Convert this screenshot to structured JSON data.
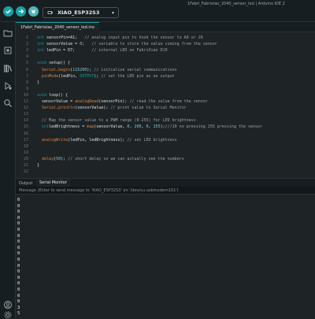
{
  "window": {
    "title": "1Fabri_Fabrixiao_2040_sensor_led | Arduino IDE 2"
  },
  "toolbar": {
    "board": "XIAO_ESP32S3"
  },
  "tabs": {
    "file": "1Fabri_Fabrixiao_2040_sensor_led.ino"
  },
  "code": [
    {
      "n": "1",
      "parts": [
        [
          "kw",
          "int"
        ],
        [
          "",
          "sensorPin=A1;   "
        ],
        [
          "cm",
          "// analog input pin to hook the sensor to A0 or 26"
        ]
      ]
    },
    {
      "n": "2",
      "parts": [
        [
          "kw",
          "int"
        ],
        [
          "",
          "sensorValue = "
        ],
        [
          "num",
          "0"
        ],
        [
          "",
          ";   "
        ],
        [
          "cm",
          "// variable to store the value coming from the sensor"
        ]
      ]
    },
    {
      "n": "3",
      "parts": [
        [
          "kw",
          "int"
        ],
        [
          "",
          "ledPin = D7;       "
        ],
        [
          "cm",
          "// internal LED on FabriXiao D10"
        ]
      ]
    },
    {
      "n": "4",
      "parts": []
    },
    {
      "n": "5",
      "parts": [
        [
          "kw",
          "void"
        ],
        [
          "",
          "setup() {"
        ]
      ]
    },
    {
      "n": "6",
      "parts": [
        [
          "",
          "  "
        ],
        [
          "fn",
          "Serial"
        ],
        [
          "",
          "."
        ],
        [
          "fn",
          "begin"
        ],
        [
          "",
          "("
        ],
        [
          "num",
          "115200"
        ],
        [
          "",
          "); "
        ],
        [
          "cm",
          "// initialize serial communications"
        ]
      ]
    },
    {
      "n": "7",
      "parts": [
        [
          "",
          "  "
        ],
        [
          "fn",
          "pinMode"
        ],
        [
          "",
          "(ledPin, "
        ],
        [
          "kw",
          "OUTPUT"
        ],
        [
          "",
          "); "
        ],
        [
          "cm",
          "// set the LED pin as an output"
        ]
      ]
    },
    {
      "n": "8",
      "parts": [
        [
          "",
          "}"
        ]
      ]
    },
    {
      "n": "9",
      "parts": []
    },
    {
      "n": "10",
      "parts": [
        [
          "kw",
          "void"
        ],
        [
          "",
          "loop() {"
        ]
      ]
    },
    {
      "n": "11",
      "parts": [
        [
          "",
          "  sensorValue = "
        ],
        [
          "fn",
          "analogRead"
        ],
        [
          "",
          "(sensorPin); "
        ],
        [
          "cm",
          "// read the value from the sensor"
        ]
      ]
    },
    {
      "n": "12",
      "parts": [
        [
          "",
          "  "
        ],
        [
          "fn",
          "Serial"
        ],
        [
          "",
          "."
        ],
        [
          "fn",
          "println"
        ],
        [
          "",
          "(sensorValue); "
        ],
        [
          "cm",
          "// print value to Serial Monitor"
        ]
      ]
    },
    {
      "n": "13",
      "parts": []
    },
    {
      "n": "14",
      "parts": [
        [
          "",
          "  "
        ],
        [
          "cm",
          "// Map the sensor value to a PWM range (0-255) for LED brightness"
        ]
      ]
    },
    {
      "n": "15",
      "parts": [
        [
          "",
          "  "
        ],
        [
          "kw",
          "int"
        ],
        [
          "",
          "ledBrightness = "
        ],
        [
          "fn",
          "map"
        ],
        [
          "",
          "(sensorValue, "
        ],
        [
          "num",
          "0"
        ],
        [
          "",
          ", "
        ],
        [
          "num",
          "200"
        ],
        [
          "",
          ", "
        ],
        [
          "num",
          "0"
        ],
        [
          "",
          ", "
        ],
        [
          "num",
          "255"
        ],
        [
          "",
          ");"
        ],
        [
          "cm",
          "///10 no pressing 255 pressing the sensor"
        ]
      ]
    },
    {
      "n": "16",
      "parts": []
    },
    {
      "n": "17",
      "parts": [
        [
          "",
          "  "
        ],
        [
          "fn",
          "analogWrite"
        ],
        [
          "",
          "(ledPin, ledBrightness); "
        ],
        [
          "cm",
          "// set LED brightness"
        ]
      ]
    },
    {
      "n": "18",
      "parts": []
    },
    {
      "n": "19",
      "parts": []
    },
    {
      "n": "20",
      "parts": [
        [
          "",
          "  "
        ],
        [
          "fn",
          "delay"
        ],
        [
          "",
          "("
        ],
        [
          "num",
          "50"
        ],
        [
          "",
          "); "
        ],
        [
          "cm",
          "// short delay so we can actually see the numbers"
        ]
      ]
    },
    {
      "n": "21",
      "parts": [
        [
          "",
          "}"
        ]
      ]
    },
    {
      "n": "22",
      "parts": []
    }
  ],
  "output": {
    "tab_output": "Output",
    "tab_serial": "Serial Monitor"
  },
  "serial": {
    "placeholder": "Message (Enter to send message to 'XIAO_ESP32S3' on '/dev/cu.usbmodem101')",
    "lines": [
      "0",
      "0",
      "0",
      "0",
      "0",
      "0",
      "0",
      "0",
      "0",
      "0",
      "0",
      "0",
      "0",
      "0",
      "0",
      "0",
      "0",
      "0",
      "3",
      "5"
    ]
  },
  "colors": {
    "accent": "#17a1a5",
    "background": "#1e2326",
    "sidebar": "#171e21"
  },
  "icons": [
    "verify-icon",
    "upload-icon",
    "debug-icon",
    "usb-icon",
    "folder-icon",
    "boards-icon",
    "library-icon",
    "debug-sidebar-icon",
    "search-icon",
    "account-icon",
    "settings-icon"
  ]
}
